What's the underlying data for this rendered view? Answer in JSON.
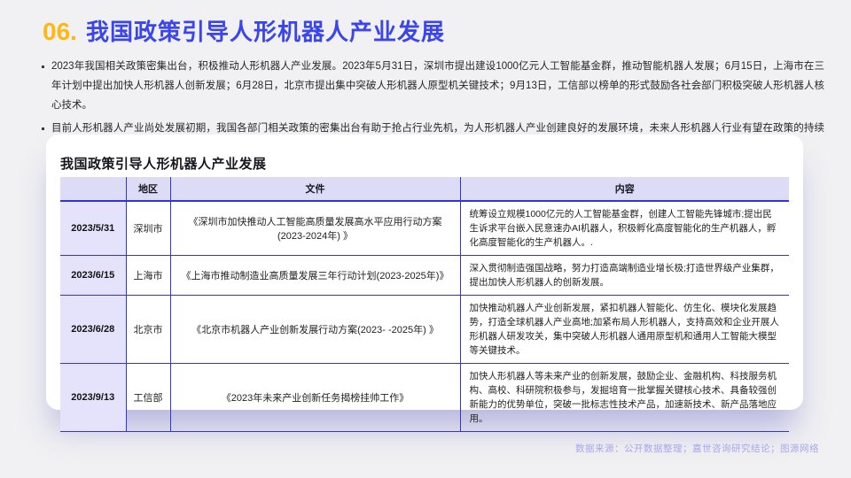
{
  "slide": {
    "number_label": "06.",
    "title": "我国政策引导人形机器人产业发展",
    "bullets": [
      "2023年我国相关政策密集出台，积极推动人形机器人产业发展。2023年5月31日，深圳市提出建设1000亿元人工智能基金群，推动智能机器人发展；6月15日，上海市在三年计划中提出加快人形机器人创新发展；6月28日，北京市提出集中突破人形机器人原型机关键技术；9月13日，工信部以榜单的形式鼓励各社会部门积极突破人形机器人核心技术。",
      "目前人形机器人产业尚处发展初期，我国各部门相关政策的密集出台有助于抢占行业先机，为人形机器人产业创建良好的发展环境，未来人形机器人行业有望在政策的持续催化下迎来加速发展的契机。"
    ],
    "footer": "数据来源：公开数据整理；嘉世咨询研究结论；图源网络"
  },
  "card": {
    "title": "我国政策引导人形机器人产业发展",
    "table": {
      "columns": [
        "",
        "地区",
        "文件",
        "内容"
      ],
      "rows": [
        [
          "2023/5/31",
          "深圳市",
          "《深圳市加快推动人工智能高质量发展高水平应用行动方案(2023-2024年) 》",
          "统筹设立规模1000亿元的人工智能基金群，创建人工智能先锋城市;提出民生诉求平台嵌入民意速办AI机器人，积极孵化高度智能化的生产机器人，孵化高度智能化的生产机器人。."
        ],
        [
          "2023/6/15",
          "上海市",
          "《上海市推动制造业高质量发展三年行动计划(2023-2025年)》",
          "深入贯彻制造强国战略，努力打造高端制造业增长极;打造世界级产业集群，提出加快人形机器人的创新发展。"
        ],
        [
          "2023/6/28",
          "北京市",
          "《北京市机器人产业创新发展行动方案(2023- -2025年) 》",
          "加快推动机器人产业创新发展，紧扣机器人智能化、仿生化、模块化发展趋势，打造全球机器人产业高地;加紧布局人形机器人，支持高效和企业开展人形机器人研发攻关，集中突破人形机器人通用原型机和通用人工智能大模型等关键技术。"
        ],
        [
          "2023/9/13",
          "工信部",
          "《2023年未来产业创新任务揭榜挂帅工作》",
          "加快人形机器人等未来产业的创新发展，鼓励企业、金融机构、科技服务机构、高校、科研院积极参与，发掘培育一批掌握关键核心技术、具备较强创新能力的优势单位，突破一批标志性技术产品，加速新技术、新产品落地应用。"
        ]
      ]
    }
  },
  "colors": {
    "accent_orange": "#FFB713",
    "title_blue": "#3A45EE",
    "table_line": "#3434D1",
    "header_bg": "#DDDCF6",
    "date_col_bg": "#E4E3FB",
    "footer_text": "#A7A7EC"
  }
}
